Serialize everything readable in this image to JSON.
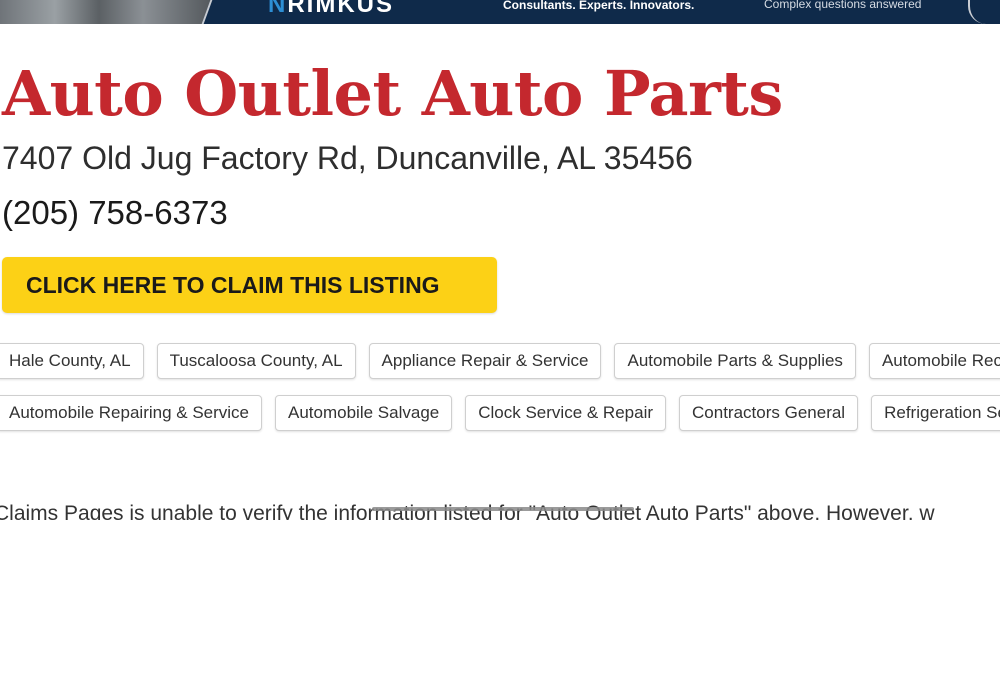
{
  "ad": {
    "logo_text": "RIMKUS",
    "tagline": "Consultants. Experts. Innovators.",
    "tagline2": "Complex questions answered"
  },
  "listing": {
    "name": "Auto Outlet Auto Parts",
    "address": "7407 Old Jug Factory Rd, Duncanville, AL 35456",
    "phone": "(205) 758-6373",
    "claim_label": "CLICK HERE TO CLAIM THIS LISTING"
  },
  "tags": {
    "row1": [
      "Hale County, AL",
      "Tuscaloosa County, AL",
      "Appliance Repair & Service",
      "Automobile Parts & Supplies",
      "Automobile Recove"
    ],
    "row2": [
      "Automobile Repairing & Service",
      "Automobile Salvage",
      "Clock Service & Repair",
      "Contractors General",
      "Refrigeration Servi"
    ]
  },
  "disclaimer": "Claims Pages is unable to verify the information listed for \"Auto Outlet Auto Parts\" above. However, w",
  "colors": {
    "title": "#c4282e",
    "claim_button": "#fcd116",
    "ad_background": "#0f2a4a"
  }
}
